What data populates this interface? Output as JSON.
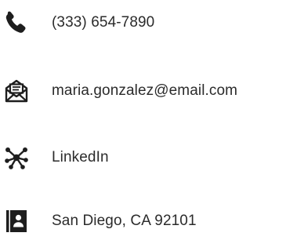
{
  "contacts": {
    "phone": {
      "icon": "phone-icon",
      "text": "(333) 654-7890"
    },
    "email": {
      "icon": "envelope-icon",
      "text": "maria.gonzalez@email.com"
    },
    "linkedin": {
      "icon": "network-icon",
      "text": "LinkedIn"
    },
    "location": {
      "icon": "address-book-icon",
      "text": "San Diego, CA 92101"
    }
  },
  "colors": {
    "icon": "#1e1e1e",
    "text": "#2b2b2b",
    "background": "#ffffff"
  }
}
